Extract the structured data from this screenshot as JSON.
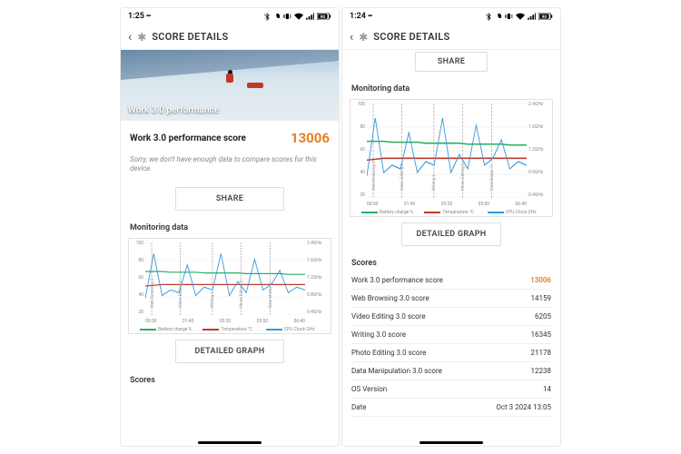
{
  "pane_left": {
    "status": {
      "time": "1:25",
      "icons": "ellipsis"
    },
    "title": "SCORE DETAILS",
    "hero_caption": "Work 3.0 performance",
    "score_label": "Work 3.0 performance score",
    "score_value": "13006",
    "info_text": "Sorry, we don't have enough data to compare scores for this device.",
    "share_btn": "SHARE",
    "monitoring_title": "Monitoring data",
    "detailed_btn": "DETAILED GRAPH",
    "scores_title": "Scores"
  },
  "pane_right": {
    "status": {
      "time": "1:24"
    },
    "title": "SCORE DETAILS",
    "share_btn": "SHARE",
    "monitoring_title": "Monitoring data",
    "detailed_btn": "DETAILED GRAPH",
    "scores_title": "Scores",
    "rows": [
      {
        "k": "Work 3.0 performance score",
        "v": "13006",
        "accent": true
      },
      {
        "k": "Web Browsing 3.0 score",
        "v": "14159"
      },
      {
        "k": "Video Editing 3.0 score",
        "v": "6205"
      },
      {
        "k": "Writing 3.0 score",
        "v": "16345"
      },
      {
        "k": "Photo Editing 3.0 score",
        "v": "21178"
      },
      {
        "k": "Data Manipulation 3.0 score",
        "v": "12238"
      },
      {
        "k": "OS Version",
        "v": "14"
      },
      {
        "k": "Date",
        "v": "Oct 3 2024 13:05"
      }
    ]
  },
  "chart_data": {
    "type": "line",
    "title": "Monitoring data",
    "x_ticks": [
      "00:00",
      "01:40",
      "03:20",
      "05:00",
      "06:40"
    ],
    "y_left_ticks": [
      "100",
      "80",
      "60",
      "40",
      "20"
    ],
    "y_right_ticks": [
      "2.4GHz",
      "1.6GHz",
      "1.2GHz",
      "0.8GHz",
      "0.4GHz"
    ],
    "legend": [
      {
        "name": "Battery charge %",
        "color": "#27ae60"
      },
      {
        "name": "Temperature °C",
        "color": "#c0392b"
      },
      {
        "name": "CPU Clock GHz",
        "color": "#3498db"
      }
    ],
    "phase_labels": [
      "Web Browsing 3",
      "Video Editing 3",
      "Writing 3",
      "Photo Editing 3",
      "Data Manip. 3"
    ],
    "phase_x": [
      0.04,
      0.22,
      0.42,
      0.6,
      0.78
    ],
    "series": [
      {
        "name": "Battery charge %",
        "axis": "left",
        "color": "#27ae60",
        "values": [
          60,
          60,
          60,
          59,
          59,
          59,
          59,
          58,
          58,
          58,
          58,
          58,
          57,
          57,
          57,
          57,
          57,
          56,
          56,
          56
        ]
      },
      {
        "name": "Temperature °C",
        "axis": "left",
        "color": "#c0392b",
        "values": [
          40,
          41,
          42,
          42,
          42,
          42,
          42,
          42,
          42,
          42,
          42,
          42,
          42,
          42,
          42,
          42,
          42,
          42,
          42,
          42
        ]
      },
      {
        "name": "CPU Clock GHz",
        "axis": "right",
        "color": "#3498db",
        "values": [
          0.6,
          2.2,
          0.7,
          0.9,
          0.8,
          1.8,
          0.7,
          1.0,
          0.9,
          2.2,
          0.7,
          1.2,
          0.8,
          2.0,
          0.9,
          1.1,
          1.6,
          0.8,
          1.0,
          0.9
        ]
      }
    ],
    "y_left_range": [
      0,
      100
    ],
    "y_right_range": [
      0,
      2.6
    ]
  },
  "status_icons": {
    "bt": "bluetooth",
    "moon": "dnd",
    "vib": "vibrate",
    "wifi": "wifi",
    "sig": "signal",
    "batt": "battery-90"
  }
}
